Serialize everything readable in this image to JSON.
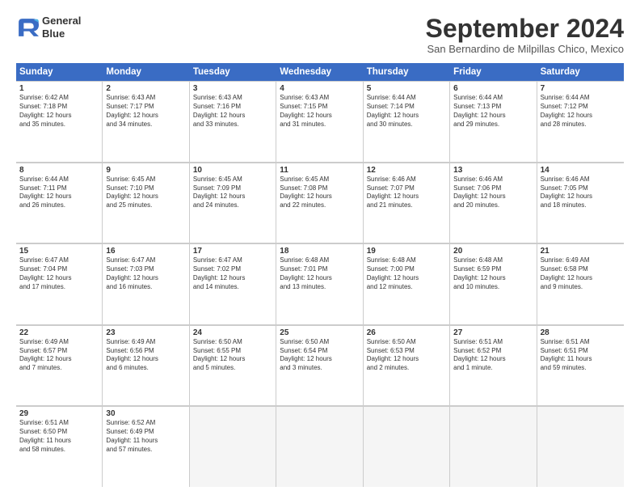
{
  "logo": {
    "line1": "General",
    "line2": "Blue"
  },
  "title": "September 2024",
  "subtitle": "San Bernardino de Milpillas Chico, Mexico",
  "header_days": [
    "Sunday",
    "Monday",
    "Tuesday",
    "Wednesday",
    "Thursday",
    "Friday",
    "Saturday"
  ],
  "rows": [
    [
      {
        "day": "1",
        "lines": [
          "Sunrise: 6:42 AM",
          "Sunset: 7:18 PM",
          "Daylight: 12 hours",
          "and 35 minutes."
        ]
      },
      {
        "day": "2",
        "lines": [
          "Sunrise: 6:43 AM",
          "Sunset: 7:17 PM",
          "Daylight: 12 hours",
          "and 34 minutes."
        ]
      },
      {
        "day": "3",
        "lines": [
          "Sunrise: 6:43 AM",
          "Sunset: 7:16 PM",
          "Daylight: 12 hours",
          "and 33 minutes."
        ]
      },
      {
        "day": "4",
        "lines": [
          "Sunrise: 6:43 AM",
          "Sunset: 7:15 PM",
          "Daylight: 12 hours",
          "and 31 minutes."
        ]
      },
      {
        "day": "5",
        "lines": [
          "Sunrise: 6:44 AM",
          "Sunset: 7:14 PM",
          "Daylight: 12 hours",
          "and 30 minutes."
        ]
      },
      {
        "day": "6",
        "lines": [
          "Sunrise: 6:44 AM",
          "Sunset: 7:13 PM",
          "Daylight: 12 hours",
          "and 29 minutes."
        ]
      },
      {
        "day": "7",
        "lines": [
          "Sunrise: 6:44 AM",
          "Sunset: 7:12 PM",
          "Daylight: 12 hours",
          "and 28 minutes."
        ]
      }
    ],
    [
      {
        "day": "8",
        "lines": [
          "Sunrise: 6:44 AM",
          "Sunset: 7:11 PM",
          "Daylight: 12 hours",
          "and 26 minutes."
        ]
      },
      {
        "day": "9",
        "lines": [
          "Sunrise: 6:45 AM",
          "Sunset: 7:10 PM",
          "Daylight: 12 hours",
          "and 25 minutes."
        ]
      },
      {
        "day": "10",
        "lines": [
          "Sunrise: 6:45 AM",
          "Sunset: 7:09 PM",
          "Daylight: 12 hours",
          "and 24 minutes."
        ]
      },
      {
        "day": "11",
        "lines": [
          "Sunrise: 6:45 AM",
          "Sunset: 7:08 PM",
          "Daylight: 12 hours",
          "and 22 minutes."
        ]
      },
      {
        "day": "12",
        "lines": [
          "Sunrise: 6:46 AM",
          "Sunset: 7:07 PM",
          "Daylight: 12 hours",
          "and 21 minutes."
        ]
      },
      {
        "day": "13",
        "lines": [
          "Sunrise: 6:46 AM",
          "Sunset: 7:06 PM",
          "Daylight: 12 hours",
          "and 20 minutes."
        ]
      },
      {
        "day": "14",
        "lines": [
          "Sunrise: 6:46 AM",
          "Sunset: 7:05 PM",
          "Daylight: 12 hours",
          "and 18 minutes."
        ]
      }
    ],
    [
      {
        "day": "15",
        "lines": [
          "Sunrise: 6:47 AM",
          "Sunset: 7:04 PM",
          "Daylight: 12 hours",
          "and 17 minutes."
        ]
      },
      {
        "day": "16",
        "lines": [
          "Sunrise: 6:47 AM",
          "Sunset: 7:03 PM",
          "Daylight: 12 hours",
          "and 16 minutes."
        ]
      },
      {
        "day": "17",
        "lines": [
          "Sunrise: 6:47 AM",
          "Sunset: 7:02 PM",
          "Daylight: 12 hours",
          "and 14 minutes."
        ]
      },
      {
        "day": "18",
        "lines": [
          "Sunrise: 6:48 AM",
          "Sunset: 7:01 PM",
          "Daylight: 12 hours",
          "and 13 minutes."
        ]
      },
      {
        "day": "19",
        "lines": [
          "Sunrise: 6:48 AM",
          "Sunset: 7:00 PM",
          "Daylight: 12 hours",
          "and 12 minutes."
        ]
      },
      {
        "day": "20",
        "lines": [
          "Sunrise: 6:48 AM",
          "Sunset: 6:59 PM",
          "Daylight: 12 hours",
          "and 10 minutes."
        ]
      },
      {
        "day": "21",
        "lines": [
          "Sunrise: 6:49 AM",
          "Sunset: 6:58 PM",
          "Daylight: 12 hours",
          "and 9 minutes."
        ]
      }
    ],
    [
      {
        "day": "22",
        "lines": [
          "Sunrise: 6:49 AM",
          "Sunset: 6:57 PM",
          "Daylight: 12 hours",
          "and 7 minutes."
        ]
      },
      {
        "day": "23",
        "lines": [
          "Sunrise: 6:49 AM",
          "Sunset: 6:56 PM",
          "Daylight: 12 hours",
          "and 6 minutes."
        ]
      },
      {
        "day": "24",
        "lines": [
          "Sunrise: 6:50 AM",
          "Sunset: 6:55 PM",
          "Daylight: 12 hours",
          "and 5 minutes."
        ]
      },
      {
        "day": "25",
        "lines": [
          "Sunrise: 6:50 AM",
          "Sunset: 6:54 PM",
          "Daylight: 12 hours",
          "and 3 minutes."
        ]
      },
      {
        "day": "26",
        "lines": [
          "Sunrise: 6:50 AM",
          "Sunset: 6:53 PM",
          "Daylight: 12 hours",
          "and 2 minutes."
        ]
      },
      {
        "day": "27",
        "lines": [
          "Sunrise: 6:51 AM",
          "Sunset: 6:52 PM",
          "Daylight: 12 hours",
          "and 1 minute."
        ]
      },
      {
        "day": "28",
        "lines": [
          "Sunrise: 6:51 AM",
          "Sunset: 6:51 PM",
          "Daylight: 11 hours",
          "and 59 minutes."
        ]
      }
    ],
    [
      {
        "day": "29",
        "lines": [
          "Sunrise: 6:51 AM",
          "Sunset: 6:50 PM",
          "Daylight: 11 hours",
          "and 58 minutes."
        ]
      },
      {
        "day": "30",
        "lines": [
          "Sunrise: 6:52 AM",
          "Sunset: 6:49 PM",
          "Daylight: 11 hours",
          "and 57 minutes."
        ]
      },
      {
        "day": "",
        "lines": []
      },
      {
        "day": "",
        "lines": []
      },
      {
        "day": "",
        "lines": []
      },
      {
        "day": "",
        "lines": []
      },
      {
        "day": "",
        "lines": []
      }
    ]
  ]
}
